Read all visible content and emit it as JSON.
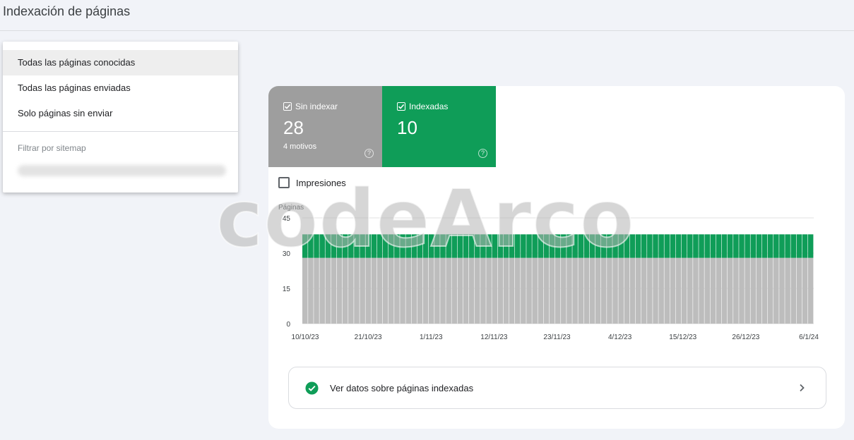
{
  "header": {
    "title": "Indexación de páginas"
  },
  "menu": {
    "items": [
      {
        "label": "Todas las páginas conocidas",
        "selected": true
      },
      {
        "label": "Todas las páginas enviadas",
        "selected": false
      },
      {
        "label": "Solo páginas sin enviar",
        "selected": false
      }
    ],
    "sitemap_heading": "Filtrar por sitemap"
  },
  "summary": {
    "not_indexed": {
      "label": "Sin indexar",
      "value": "28",
      "sub": "4 motivos",
      "checked": true,
      "color": "#9e9e9e",
      "help_icon": "help-circle-icon"
    },
    "indexed": {
      "label": "Indexadas",
      "value": "10",
      "checked": true,
      "color": "#0f9d58",
      "help_icon": "help-circle-icon"
    }
  },
  "impressions": {
    "label": "Impresiones",
    "checked": false
  },
  "chart_data": {
    "type": "bar",
    "stacked": true,
    "ylabel": "Páginas",
    "ylim": [
      0,
      45
    ],
    "yticks": [
      "45",
      "30",
      "15",
      "0"
    ],
    "xticks": [
      "10/10/23",
      "21/10/23",
      "1/11/23",
      "12/11/23",
      "23/11/23",
      "4/12/23",
      "15/12/23",
      "26/12/23",
      "6/1/24"
    ],
    "x_range": [
      "10/10/23",
      "6/1/24"
    ],
    "series": [
      {
        "name": "Sin indexar",
        "value_per_day": 28,
        "color": "#bdbdbd"
      },
      {
        "name": "Indexadas",
        "value_per_day": 10,
        "color": "#0f9d58"
      }
    ]
  },
  "footer_link": {
    "label": "Ver datos sobre páginas indexadas",
    "icon": "check-circle-icon",
    "chevron": "chevron-right-icon"
  },
  "watermark": "codeArco"
}
